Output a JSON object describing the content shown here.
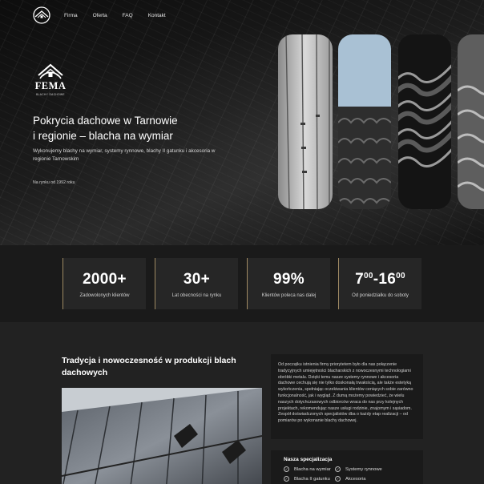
{
  "nav": {
    "links": [
      "Firma",
      "Oferta",
      "FAQ",
      "Kontakt"
    ]
  },
  "brand": {
    "name": "FEMA",
    "subtitle": "BLACHY DACHOWE"
  },
  "hero": {
    "title_line1": "Pokrycia dachowe w Tarnowie",
    "title_line2": "i regionie – blacha na wymiar",
    "description": "Wykonujemy blachy na wymiar, systemy rynnowe, blachy II gatunku i akcesoria w regionie Tarnowskim",
    "since": "Na rynku od 1992 roku"
  },
  "stats": [
    {
      "value": "2000+",
      "label": "Zadowolonych klientów"
    },
    {
      "value": "30+",
      "label": "Lat obecności na rynku"
    },
    {
      "value": "99%",
      "label": "Klientów poleca nas dalej"
    },
    {
      "value_start": "7",
      "value_start_sup": "00",
      "value_sep": "-",
      "value_end": "16",
      "value_end_sup": "00",
      "label": "Od poniedziałku do soboty"
    }
  ],
  "about": {
    "title": "Tradycja i nowoczesność w produkcji blach dachowych",
    "text": "Od początku istnienia firmy priorytetem było dla nas połączenie tradycyjnych umiejętności blacharskich z nowoczesnymi technologiami obróbki metalu. Dzięki temu nasze systemy rynnowe i akcesoria dachowe cechują się nie tylko doskonałą trwałością, ale także estetyką wykończenia, spełniając oczekiwania klientów ceniących sobie zarówno funkcjonalność, jak i wygląd. Z dumą możemy powiedzieć, że wielu naszych dotychczasowych odbiorców wraca do nas przy kolejnych projektach, rekomendując nasze usługi rodzinie, znajomym i sąsiadom. Zespół doświadczonych specjalistów dba o każdy etap realizacji – od pomiarów po wykonanie blachy dachowej.",
    "spec_title": "Nasza specjalizacja",
    "spec_items": [
      "Blacha na wymiar",
      "Systemy rynnowe",
      "Blacha II gatunku",
      "Akcesoria"
    ]
  },
  "colors": {
    "background": "#1f1f1f",
    "card": "#262626",
    "accent_gold": "#a08a63",
    "text": "#ffffff"
  },
  "icons": {
    "nav_logo": "house-roof-logo-icon",
    "brand_logo": "house-roof-logo-icon",
    "spec_check": "check-circle-icon"
  }
}
